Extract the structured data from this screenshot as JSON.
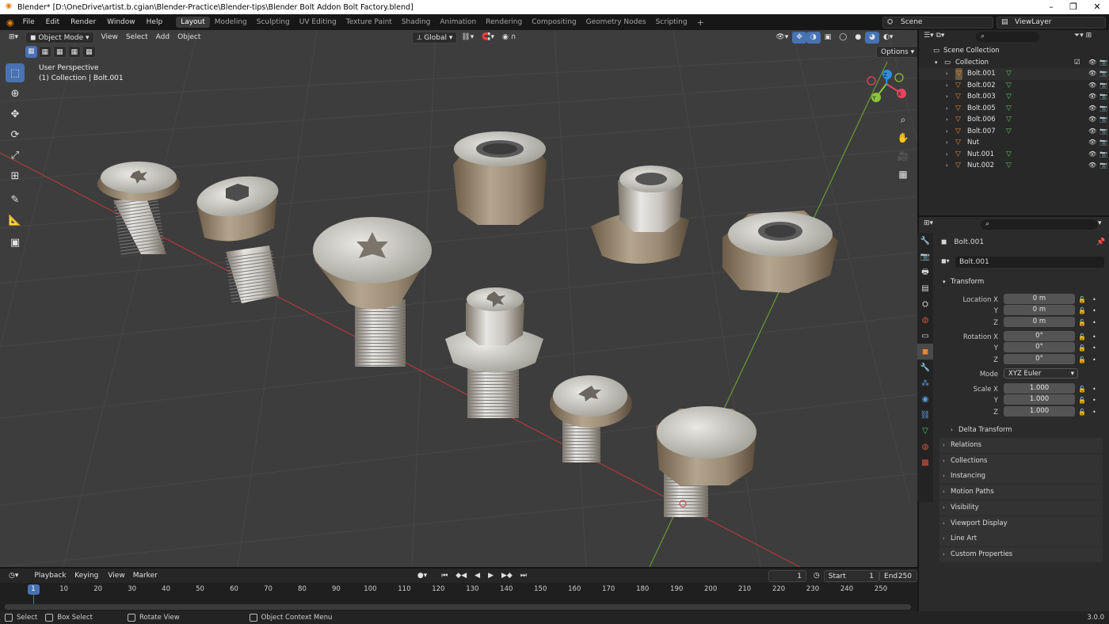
{
  "title": "Blender* [D:\\OneDrive\\artist.b.cgian\\Blender-Practice\\Blender-tips\\Blender Bolt Addon Bolt Factory.blend]",
  "menu": [
    "File",
    "Edit",
    "Render",
    "Window",
    "Help"
  ],
  "workspaces": [
    {
      "label": "Layout",
      "active": true
    },
    {
      "label": "Modeling",
      "active": false
    },
    {
      "label": "Sculpting",
      "active": false
    },
    {
      "label": "UV Editing",
      "active": false
    },
    {
      "label": "Texture Paint",
      "active": false
    },
    {
      "label": "Shading",
      "active": false
    },
    {
      "label": "Animation",
      "active": false
    },
    {
      "label": "Rendering",
      "active": false
    },
    {
      "label": "Compositing",
      "active": false
    },
    {
      "label": "Geometry Nodes",
      "active": false
    },
    {
      "label": "Scripting",
      "active": false
    }
  ],
  "add_workspace": "+",
  "scene": "Scene",
  "view_layer": "ViewLayer",
  "viewport": {
    "mode": "Object Mode",
    "menus": [
      "View",
      "Select",
      "Add",
      "Object"
    ],
    "transform_orientation": "Global",
    "options_label": "Options",
    "perspective_label": "User Perspective",
    "collection_label": "(1) Collection | Bolt.001",
    "gizmo": {
      "x": "X",
      "y": "Y",
      "z": "Z"
    }
  },
  "outliner": {
    "root": "Scene Collection",
    "collection": "Collection",
    "items": [
      "Bolt.001",
      "Bolt.002",
      "Bolt.003",
      "Bolt.005",
      "Bolt.006",
      "Bolt.007",
      "Nut",
      "Nut.001",
      "Nut.002"
    ]
  },
  "properties": {
    "object_name": "Bolt.001",
    "data_name": "Bolt.001",
    "transform_title": "Transform",
    "location": {
      "label": "Location X",
      "x": "0 m",
      "y": "0 m",
      "z": "0 m"
    },
    "rotation": {
      "label": "Rotation X",
      "x": "0°",
      "y": "0°",
      "z": "0°"
    },
    "mode_label": "Mode",
    "mode_value": "XYZ Euler",
    "scale": {
      "label": "Scale X",
      "x": "1.000",
      "y": "1.000",
      "z": "1.000"
    },
    "axis_y": "Y",
    "axis_z": "Z",
    "delta_transform": "Delta Transform",
    "sections": [
      "Relations",
      "Collections",
      "Instancing",
      "Motion Paths",
      "Visibility",
      "Viewport Display",
      "Line Art",
      "Custom Properties"
    ]
  },
  "timeline": {
    "menus": [
      "Playback",
      "Keying",
      "View",
      "Marker"
    ],
    "current_frame": "1",
    "start_label": "Start",
    "start": "1",
    "end_label": "End",
    "end": "250",
    "ticks": [
      "1",
      "10",
      "20",
      "30",
      "40",
      "50",
      "60",
      "70",
      "80",
      "90",
      "100",
      "110",
      "120",
      "130",
      "140",
      "150",
      "160",
      "170",
      "180",
      "190",
      "200",
      "210",
      "220",
      "230",
      "240",
      "250"
    ],
    "tick_frames": [
      1,
      10,
      20,
      30,
      40,
      50,
      60,
      70,
      80,
      90,
      100,
      110,
      120,
      130,
      140,
      150,
      160,
      170,
      180,
      190,
      200,
      210,
      220,
      230,
      240,
      250
    ]
  },
  "status": {
    "select": "Select",
    "box_select": "Box Select",
    "rotate_view": "Rotate View",
    "context_menu": "Object Context Menu",
    "version": "3.0.0"
  },
  "colors": {
    "accent": "#4772b3",
    "x_axis": "#e5475e",
    "y_axis": "#8bc43a",
    "z_axis": "#2f8fdf",
    "mesh_icon": "#e8862f",
    "data_icon": "#5fc45f"
  }
}
